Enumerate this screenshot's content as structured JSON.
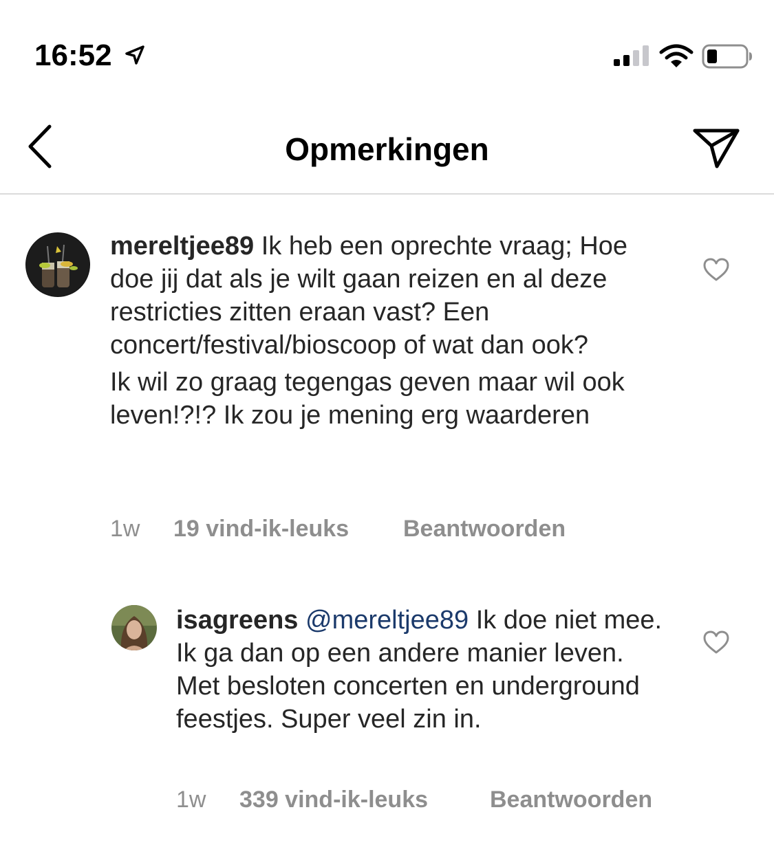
{
  "status_bar": {
    "time": "16:52",
    "icons": [
      "location-arrow-icon",
      "signal-icon",
      "wifi-icon",
      "battery-icon"
    ]
  },
  "header": {
    "title": "Opmerkingen",
    "back_icon": "chevron-left-icon",
    "share_icon": "paper-plane-icon"
  },
  "comments": [
    {
      "username": "mereltjee89",
      "text_lines": [
        " Ik heb een oprechte vraag; Hoe doe jij dat als je wilt gaan reizen en al deze restricties zitten eraan vast? Een concert/festival/bioscoop of wat dan ook?",
        "Ik wil zo graag tegengas geven maar wil ook leven!?!? Ik zou je mening erg waarderen"
      ],
      "time": "1w",
      "likes": "19 vind-ik-leuks",
      "reply": "Beantwoorden"
    },
    {
      "username": "isagreens",
      "mention": "@mereltjee89",
      "text": " Ik doe niet mee. Ik ga dan op een andere manier leven. Met besloten concerten en underground feestjes. Super veel zin in.",
      "time": "1w",
      "likes": "339 vind-ik-leuks",
      "reply": "Beantwoorden"
    }
  ],
  "colors": {
    "text": "#262626",
    "meta": "#8e8e8e",
    "mention": "#1b3a6b",
    "divider": "#dbdbdb"
  }
}
